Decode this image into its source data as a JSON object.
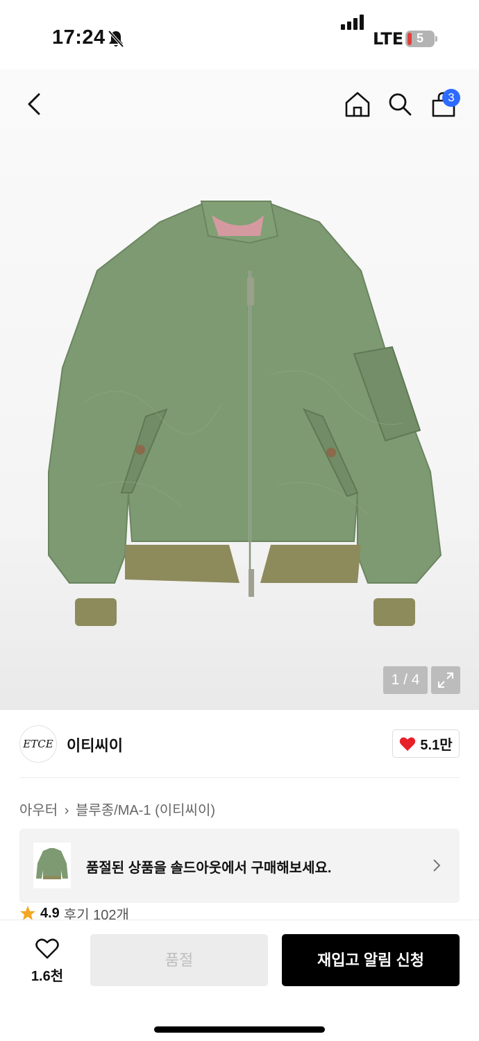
{
  "status_bar": {
    "time": "17:24",
    "network": "LTE",
    "battery": "5"
  },
  "nav": {
    "cart_count": "3"
  },
  "gallery": {
    "page_indicator": "1 / 4"
  },
  "brand": {
    "logo_text": "ETCE",
    "name": "이티씨이",
    "likes": "5.1만"
  },
  "breadcrumb": {
    "items": [
      "아우터",
      "블루종/MA-1 (이티씨이)"
    ]
  },
  "soldout_banner": {
    "text": "품절된 상품을 솔드아웃에서 구매해보세요."
  },
  "rating": {
    "score": "4.9",
    "reviews": "후기 102개"
  },
  "bottom_bar": {
    "wish_count": "1.6천",
    "soldout_label": "품절",
    "restock_label": "재입고 알림 신청"
  },
  "colors": {
    "accent_blue": "#2d6bff",
    "heart_red": "#e8202a",
    "star_orange": "#f5a623",
    "jacket_green": "#7e9a72"
  }
}
